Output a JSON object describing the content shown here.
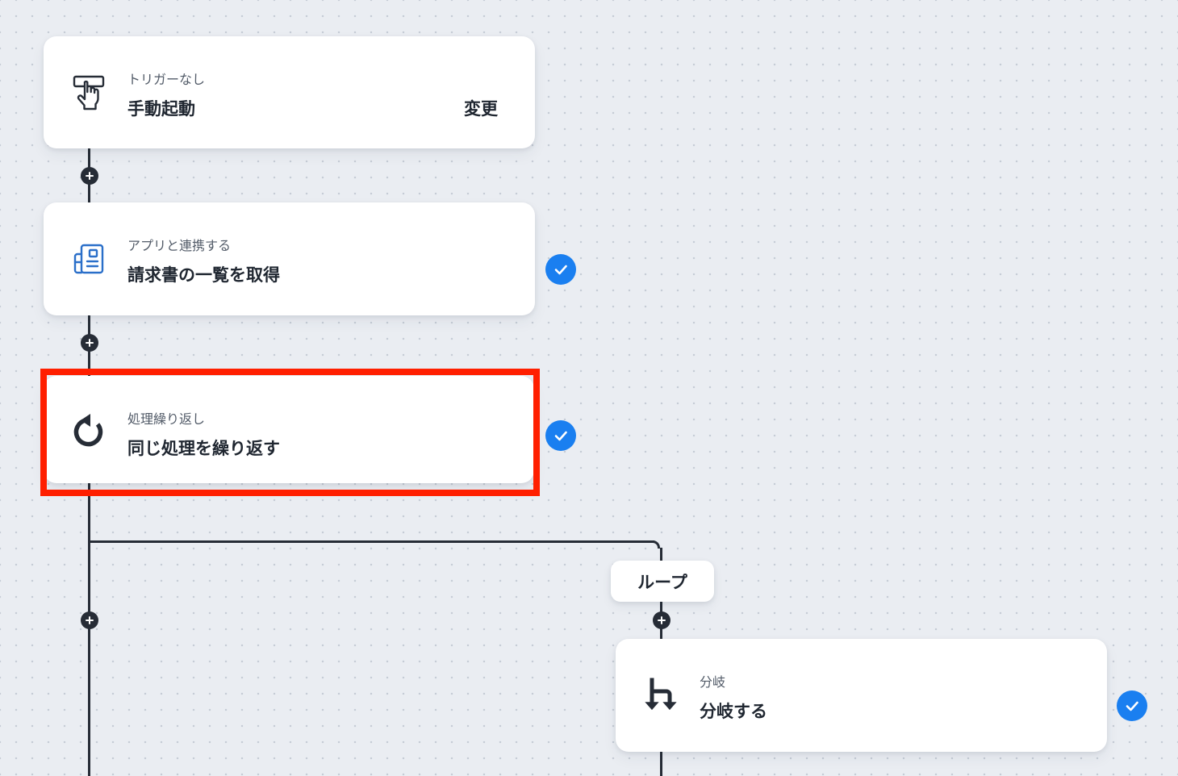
{
  "flow": {
    "trigger": {
      "subtitle": "トリガーなし",
      "title": "手動起動",
      "change_label": "変更",
      "icon": "hand-pointer-icon"
    },
    "app_step": {
      "subtitle": "アプリと連携する",
      "title": "請求書の一覧を取得",
      "icon": "invoice-document-icon",
      "status": "completed"
    },
    "loop_step": {
      "subtitle": "処理繰り返し",
      "title": "同じ処理を繰り返す",
      "icon": "loop-arrow-icon",
      "status": "completed",
      "highlighted": true
    },
    "loop_label": "ループ",
    "branch_step": {
      "subtitle": "分岐",
      "title": "分岐する",
      "icon": "branch-arrows-icon",
      "status": "completed"
    }
  },
  "colors": {
    "canvas_background": "#eaedf2",
    "connector": "#262c36",
    "check_badge": "#1a7ff0",
    "highlight_border": "#ff1f00",
    "app_icon": "#2a6fc9"
  }
}
